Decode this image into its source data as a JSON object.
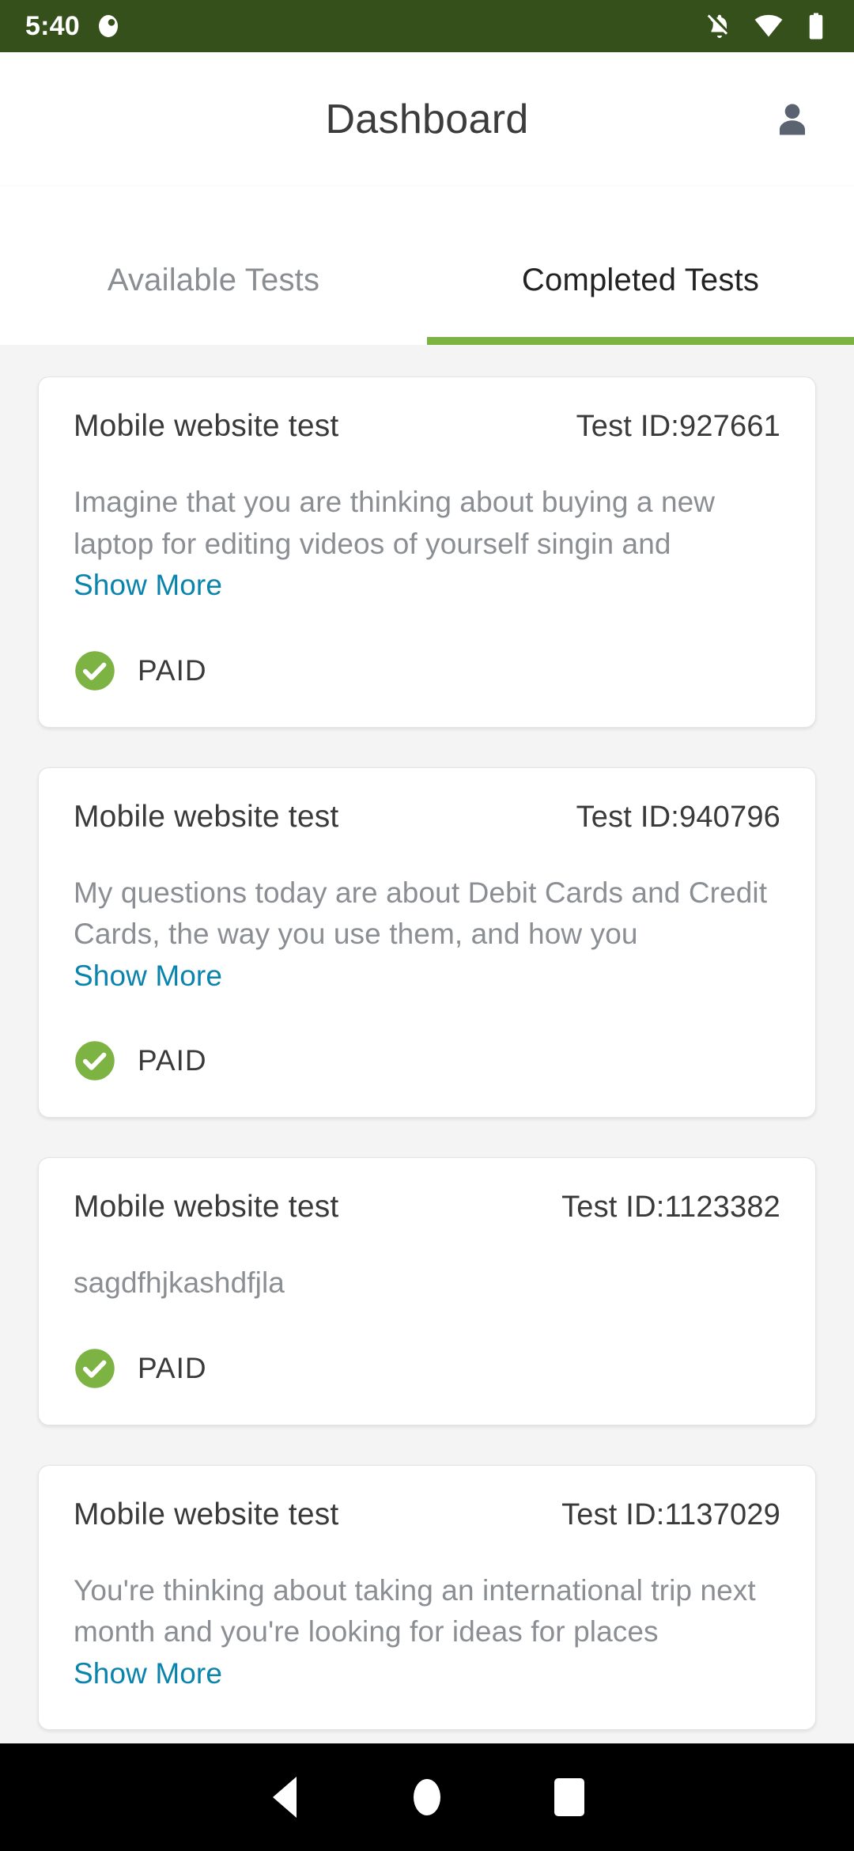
{
  "status_bar": {
    "time": "5:40",
    "app_notification_icon": "circle-app-icon",
    "icons": [
      "notifications-off-icon",
      "wifi-icon",
      "battery-icon"
    ],
    "background_color": "#35501a"
  },
  "app_bar": {
    "title": "Dashboard",
    "avatar_icon": "person-account-icon"
  },
  "tabs": {
    "accent_color": "#7cb342",
    "items": [
      {
        "label": "Available Tests",
        "active": false
      },
      {
        "label": "Completed Tests",
        "active": true
      }
    ]
  },
  "link_color": "#0b84ad",
  "cards": [
    {
      "title": "Mobile website test",
      "test_id": "Test ID:927661",
      "description": "Imagine that you are thinking about buying a new laptop for editing videos of yourself singin and",
      "show_more": "Show More",
      "status": "PAID",
      "status_icon": "check-circle-icon"
    },
    {
      "title": "Mobile website test",
      "test_id": "Test ID:940796",
      "description": "My questions today are about Debit Cards and Credit Cards, the way you use them, and how you",
      "show_more": "Show More",
      "status": "PAID",
      "status_icon": "check-circle-icon"
    },
    {
      "title": "Mobile website test",
      "test_id": "Test ID:1123382",
      "description": "sagdfhjkashdfjla",
      "show_more": "",
      "status": "PAID",
      "status_icon": "check-circle-icon"
    },
    {
      "title": "Mobile website test",
      "test_id": "Test ID:1137029",
      "description": "You're thinking about taking an international trip next month and you're looking for ideas for places",
      "show_more": "Show More",
      "status": "",
      "status_icon": ""
    }
  ],
  "nav_bar": {
    "back": "back-button",
    "home": "home-button",
    "recents": "recents-button"
  }
}
